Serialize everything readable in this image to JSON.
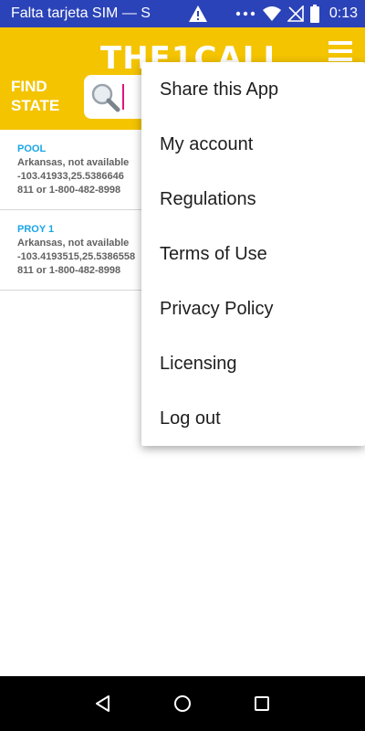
{
  "status_bar": {
    "carrier": "Falta tarjeta SIM — S",
    "time": "0:13",
    "icons": [
      "warning-icon",
      "more-dots-icon",
      "wifi-icon",
      "no-signal-icon",
      "battery-icon"
    ]
  },
  "header": {
    "title": "THE1CALL",
    "find_state": "FIND STATE",
    "search": {
      "value": "",
      "placeholder": ""
    },
    "brand_color": "#f4c400"
  },
  "list": {
    "items": [
      {
        "name": "POOL",
        "location": "Arkansas, not available",
        "coords": "-103.41933,25.5386646",
        "phone": "811 or 1-800-482-8998"
      },
      {
        "name": "PROY 1",
        "location": "Arkansas, not available",
        "coords": "-103.4193515,25.5386558",
        "phone": "811 or 1-800-482-8998"
      }
    ]
  },
  "menu": {
    "items": [
      {
        "label": "Share this App"
      },
      {
        "label": "My account"
      },
      {
        "label": "Regulations"
      },
      {
        "label": "Terms of Use"
      },
      {
        "label": "Privacy Policy"
      },
      {
        "label": "Licensing"
      },
      {
        "label": "Log out"
      }
    ]
  },
  "nav_bar": {
    "icons": [
      "back-icon",
      "home-icon",
      "recents-icon"
    ]
  }
}
